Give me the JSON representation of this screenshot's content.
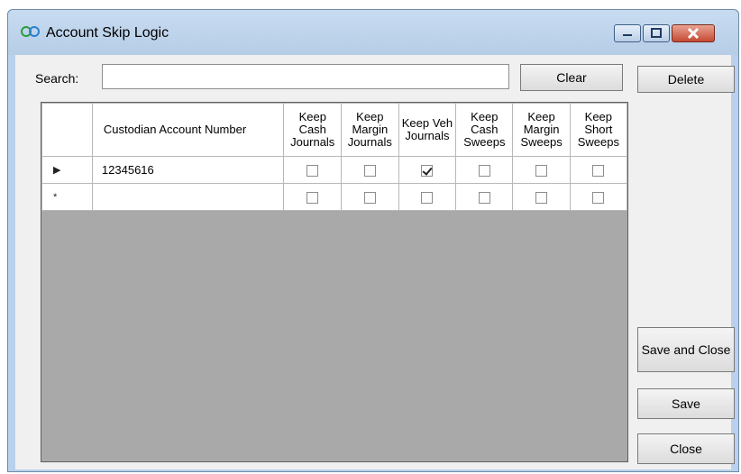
{
  "window": {
    "title": "Account Skip Logic",
    "icon": "infinity-app-icon",
    "controls": [
      "minimize-icon",
      "maximize-icon",
      "close-icon"
    ]
  },
  "search": {
    "label": "Search:",
    "value": "",
    "placeholder": ""
  },
  "buttons": {
    "clear": "Clear",
    "delete": "Delete",
    "save_and_close": "Save and Close",
    "save": "Save",
    "close": "Close"
  },
  "grid": {
    "columns": [
      "",
      "Custodian Account Number",
      "Keep Cash Journals",
      "Keep Margin Journals",
      "Keep Veh Journals",
      "Keep Cash Sweeps",
      "Keep Margin Sweeps",
      "Keep Short Sweeps"
    ],
    "rows": [
      {
        "selector": "▶",
        "account": "12345616",
        "checks": [
          false,
          false,
          true,
          false,
          false,
          false
        ]
      },
      {
        "selector": "*",
        "account": "",
        "checks": [
          false,
          false,
          false,
          false,
          false,
          false
        ]
      }
    ]
  },
  "colors": {
    "title_bar": "#b9d1ea",
    "grid_background": "#a9a9a9",
    "close_button": "#c64a34"
  }
}
